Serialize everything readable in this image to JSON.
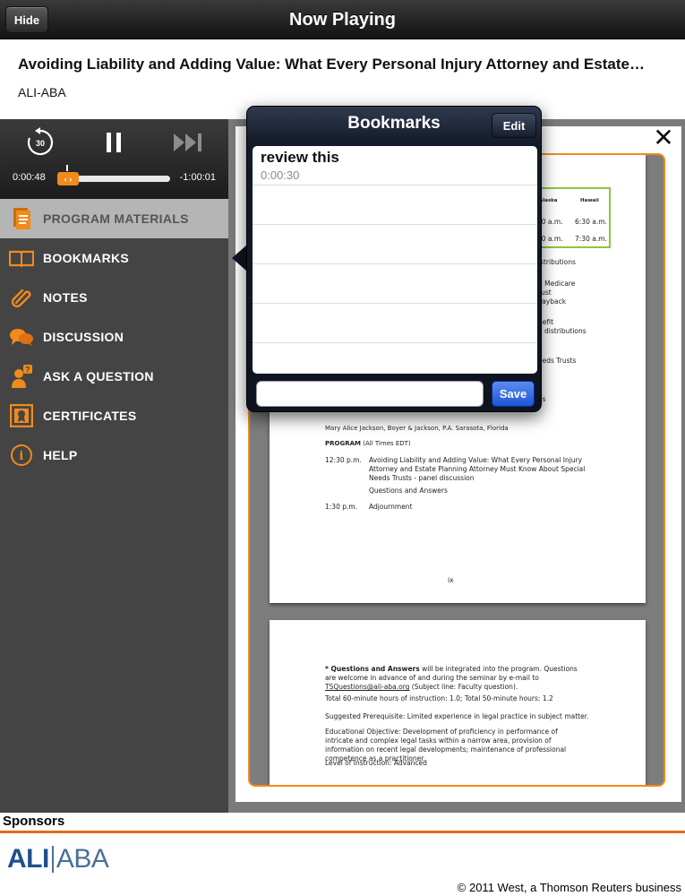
{
  "navbar": {
    "hide_label": "Hide",
    "title": "Now Playing"
  },
  "program": {
    "title": "Avoiding Liability and Adding Value: What Every Personal Injury Attorney and Estate…",
    "org": "ALI-ABA"
  },
  "player": {
    "replay_seconds": "30",
    "elapsed": "0:00:48",
    "remaining": "-1:00:01",
    "progress": 0.013,
    "thumb_glyph": "‹ ›"
  },
  "menu": [
    {
      "label": "PROGRAM MATERIALS",
      "icon": "document-stack-icon",
      "active": true
    },
    {
      "label": "BOOKMARKS",
      "icon": "open-book-icon",
      "active": false
    },
    {
      "label": "NOTES",
      "icon": "paperclip-icon",
      "active": false
    },
    {
      "label": "DISCUSSION",
      "icon": "speech-bubbles-icon",
      "active": false
    },
    {
      "label": "ASK A QUESTION",
      "icon": "person-question-icon",
      "active": false
    },
    {
      "label": "CERTIFICATES",
      "icon": "certificate-icon",
      "active": false
    },
    {
      "label": "HELP",
      "icon": "info-icon",
      "active": false
    }
  ],
  "popover": {
    "title": "Bookmarks",
    "edit_label": "Edit",
    "save_label": "Save",
    "input_value": "",
    "bookmarks": [
      {
        "title": "review this",
        "time": "0:00:30"
      }
    ],
    "empty_rows": 4
  },
  "document": {
    "page1": {
      "table_headers": [
        "Alaska",
        "Hawaii"
      ],
      "table_rows": [
        [
          "30 a.m.",
          "6:30 a.m."
        ],
        [
          "30 a.m.",
          "7:30 a.m."
        ]
      ],
      "right_fragments": [
        "istributions",
        "d Medicare",
        "rust",
        "Payback",
        "nefit",
        "e distributions",
        "eeds Trusts",
        "as"
      ],
      "faculty": "Mary Alice Jackson, Boyer & Jackson, P.A. Sarasota, Florida",
      "program_heading": "PROGRAM",
      "program_tz": "(All Times EDT)",
      "schedule": [
        {
          "time": "12:30 p.m.",
          "text": "Avoiding Liability and Adding Value: What Every Personal Injury Attorney and Estate Planning Attorney Must Know About Special Needs Trusts - panel discussion"
        },
        {
          "time": "",
          "text": "Questions and Answers"
        },
        {
          "time": "1:30 p.m.",
          "text": "Adjournment"
        }
      ],
      "page_number": "ix"
    },
    "page2": {
      "qa_bold": "* Questions and Answers",
      "qa_text": " will be integrated into the program. Questions are welcome in advance of and during the seminar by e-mail to ",
      "qa_email": "TSQuestions@ali-aba.org",
      "qa_tail": " (Subject line: Faculty question).",
      "hours": "Total 60-minute hours of instruction: 1.0; Total 50-minute hours: 1.2",
      "prereq": "Suggested Prerequisite: Limited experience in legal practice in subject matter.",
      "objective": "Educational Objective: Development of proficiency in performance of intricate and complex legal tasks within a narrow area, provision of information on recent legal developments; maintenance of professional competence as a practitioner.",
      "level": "Level of Instruction: Advanced"
    }
  },
  "sponsors": {
    "label": "Sponsors",
    "logo_left": "ALI",
    "logo_right": "ABA",
    "copyright": "© 2011 West, a Thomson Reuters business"
  },
  "colors": {
    "accent": "#f08a1c",
    "sidebar": "#444444",
    "popover": "#131a28",
    "save": "#1f55d8"
  }
}
